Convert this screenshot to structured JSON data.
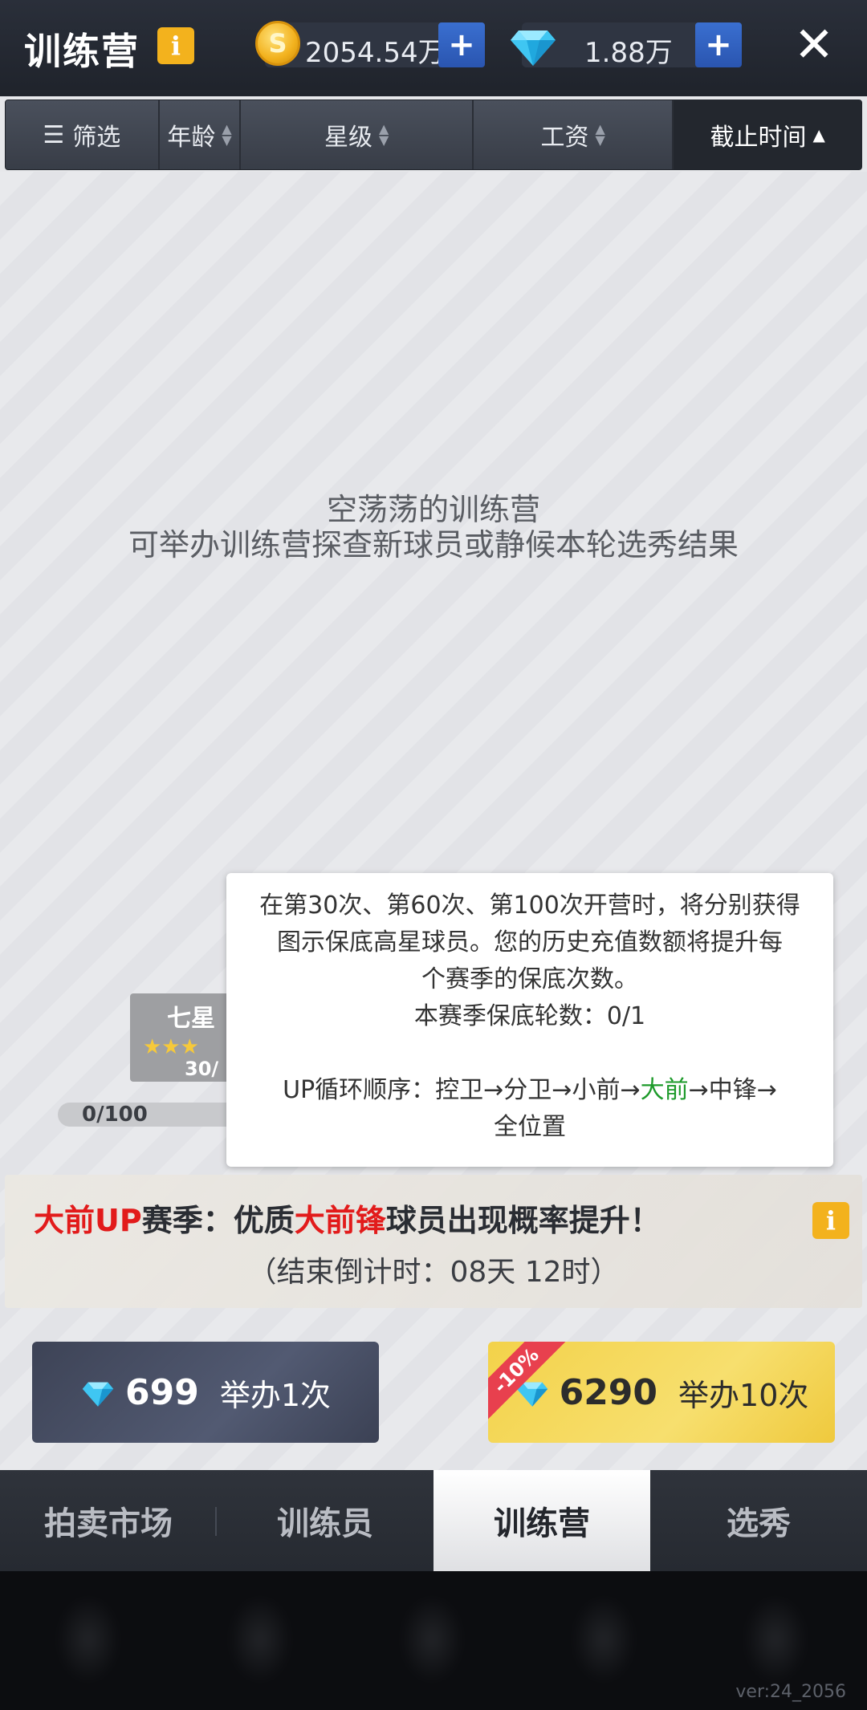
{
  "header": {
    "title": "训练营",
    "info_icon": "i",
    "coins": "2054.54万",
    "coin_symbol": "S",
    "gems": "1.88万",
    "plus": "+",
    "close": "✕"
  },
  "filter_bar": {
    "filter_label": "筛选",
    "age": "年龄",
    "stars": "星级",
    "salary": "工资",
    "deadline": "截止时间"
  },
  "empty": {
    "line1": "空荡荡的训练营",
    "line2": "可举办训练营探查新球员或静候本轮选秀结果"
  },
  "progress": {
    "star_label": "七星",
    "star_count": "30/",
    "stars": "★★★",
    "value_text": "0/100"
  },
  "tooltip": {
    "line1": "在第30次、第60次、第100次开营时，将分别获得",
    "line2": "图示保底高星球员。您的历史充值数额将提升每",
    "line3": "个赛季的保底次数。",
    "line4": "本赛季保底轮数：0/1",
    "line5_prefix": "UP循环顺序：控卫→分卫→小前→",
    "line5_green": "大前",
    "line5_suffix": "→中锋→",
    "line6": "全位置"
  },
  "season": {
    "red1": "大前UP",
    "text1": "赛季：优质",
    "red2": "大前锋",
    "text2": "球员出现概率提升！",
    "countdown": "（结束倒计时：08天 12时）"
  },
  "actions": {
    "once_price": "699",
    "once_label": "举办1次",
    "ten_price": "6290",
    "ten_label": "举办10次",
    "discount": "-10%"
  },
  "tabs": [
    {
      "label": "拍卖市场"
    },
    {
      "label": "训练员"
    },
    {
      "label": "训练营"
    },
    {
      "label": "选秀"
    }
  ],
  "version": "ver:24_2056",
  "colors": {
    "accent_gold": "#f3b21d",
    "plus_blue": "#2a55b0",
    "highlight_red": "#e21b1b",
    "highlight_green": "#1d9a2a"
  }
}
